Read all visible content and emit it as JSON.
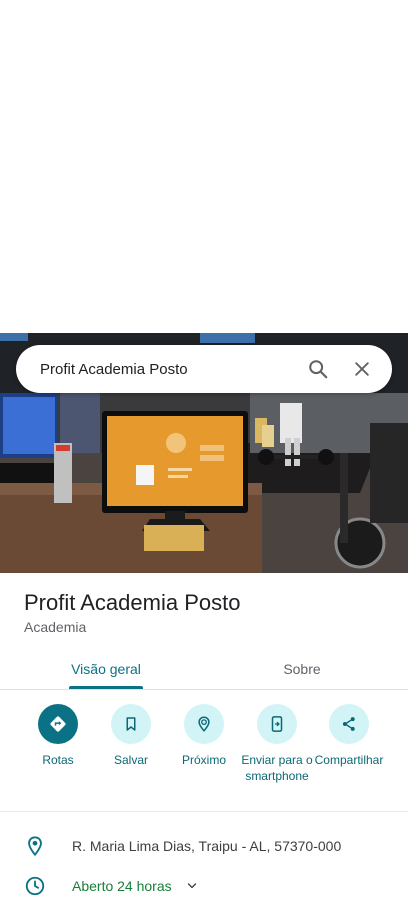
{
  "search": {
    "query": "Profit Academia Posto"
  },
  "place": {
    "name": "Profit Academia Posto",
    "category": "Academia"
  },
  "tabs": [
    {
      "label": "Visão geral",
      "selected": true
    },
    {
      "label": "Sobre",
      "selected": false
    }
  ],
  "actions": [
    {
      "label": "Rotas",
      "icon": "directions-icon"
    },
    {
      "label": "Salvar",
      "icon": "bookmark-icon"
    },
    {
      "label": "Próximo",
      "icon": "nearby-icon"
    },
    {
      "label": "Enviar para o smartphone",
      "icon": "send-to-phone-icon"
    },
    {
      "label": "Compartilhar",
      "icon": "share-icon"
    }
  ],
  "info": {
    "address": "R. Maria Lima Dias, Traipu - AL, 57370-000",
    "hours": "Aberto 24 horas"
  },
  "colors": {
    "accent": "#0b7285",
    "action_bg": "#d2f4f7",
    "open_text": "#188038"
  }
}
